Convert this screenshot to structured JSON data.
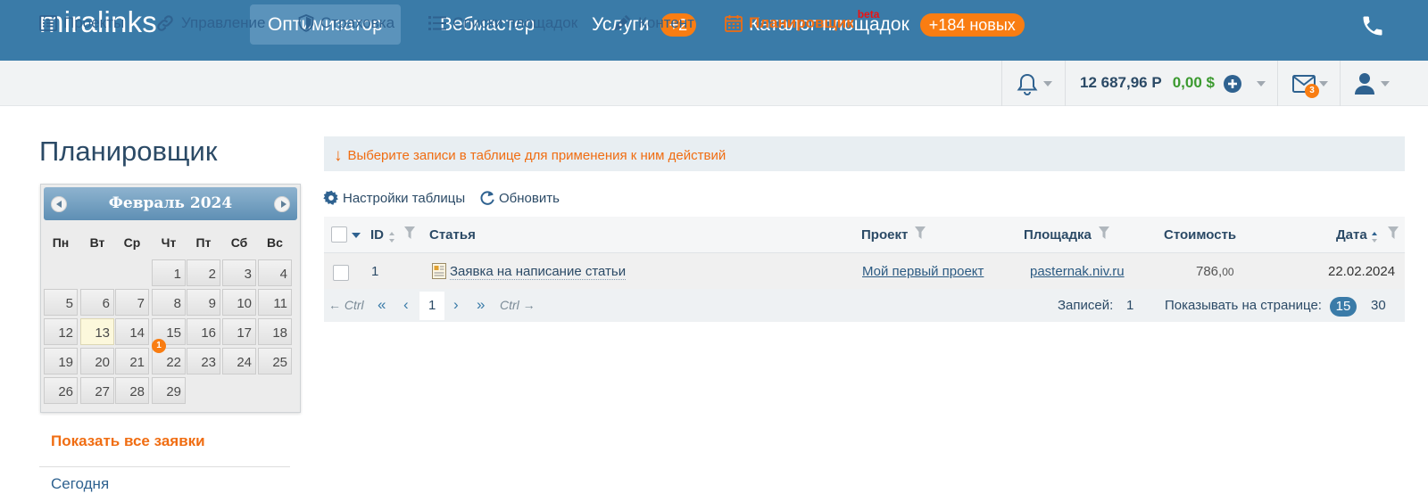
{
  "app": {
    "logo": "miralinks"
  },
  "topnav": {
    "optimizer": "Оптимизатор",
    "webmaster": "Вебмастер",
    "services": "Услуги",
    "services_badge": "+2",
    "catalog": "Каталог площадок",
    "catalog_badge": "+184 новых"
  },
  "subnav": {
    "projects": "Проекты",
    "management": "Управление",
    "insurance": "Страховка",
    "lists": "Списки площадок",
    "content": "Контент",
    "planner": "Планировщик",
    "planner_beta": "beta"
  },
  "account": {
    "balance_rub": "12 687,96 Р",
    "balance_usd": "0,00 $",
    "mail_count": "3"
  },
  "page": {
    "title": "Планировщик"
  },
  "calendar": {
    "month": "Февраль 2024",
    "weekdays": [
      "Пн",
      "Вт",
      "Ср",
      "Чт",
      "Пт",
      "Сб",
      "Вс"
    ],
    "days": [
      "1",
      "2",
      "3",
      "4",
      "5",
      "6",
      "7",
      "8",
      "9",
      "10",
      "11",
      "12",
      "13",
      "14",
      "15",
      "16",
      "17",
      "18",
      "19",
      "20",
      "21",
      "22",
      "23",
      "24",
      "25",
      "26",
      "27",
      "28",
      "29"
    ],
    "first_weekday_index": 3,
    "today": "13",
    "badge_day": "22",
    "badge_count": "1"
  },
  "filters": {
    "show_all": "Показать все заявки",
    "today": "Сегодня"
  },
  "notice": {
    "arrow": "↓",
    "text": "Выберите записи в таблице для применения к ним действий"
  },
  "toolbar": {
    "settings": "Настройки таблицы",
    "refresh": "Обновить"
  },
  "table": {
    "headers": {
      "id": "ID",
      "article": "Статья",
      "project": "Проект",
      "site": "Площадка",
      "cost": "Стоимость",
      "date": "Дата"
    },
    "rows": [
      {
        "id": "1",
        "article": "Заявка на написание статьи",
        "project": "Мой первый проект",
        "site": "pasternak.niv.ru",
        "cost_int": "786,",
        "cost_frac": "00",
        "date": "22.02.2024"
      }
    ]
  },
  "pagination": {
    "prev_ctrl": "← Ctrl",
    "first": "«",
    "prev": "‹",
    "current": "1",
    "next": "›",
    "last": "»",
    "next_ctrl": "Ctrl →",
    "records_label": "Записей:",
    "records_count": "1",
    "per_page_label": "Показывать на странице:",
    "per_page_current": "15",
    "per_page_other": "30"
  }
}
